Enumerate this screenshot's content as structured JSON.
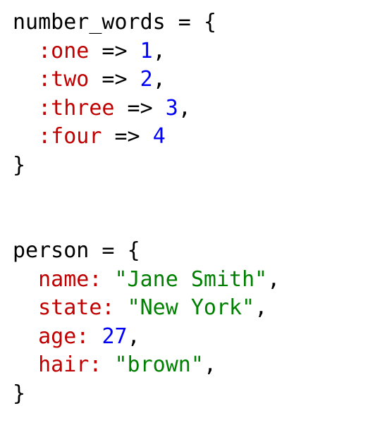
{
  "block1": {
    "varName": "number_words",
    "assign": " = ",
    "openBrace": "{",
    "closeBrace": "}",
    "entries": [
      {
        "key": ":one",
        "arrow": " => ",
        "value": "1",
        "comma": ","
      },
      {
        "key": ":two",
        "arrow": " => ",
        "value": "2",
        "comma": ","
      },
      {
        "key": ":three",
        "arrow": " => ",
        "value": "3",
        "comma": ","
      },
      {
        "key": ":four",
        "arrow": " => ",
        "value": "4",
        "comma": ""
      }
    ]
  },
  "block2": {
    "varName": "person",
    "assign": " = ",
    "openBrace": "{",
    "closeBrace": "}",
    "entries": [
      {
        "key": "name:",
        "space": " ",
        "value": "\"Jane Smith\"",
        "valueType": "str",
        "comma": ","
      },
      {
        "key": "state:",
        "space": " ",
        "value": "\"New York\"",
        "valueType": "str",
        "comma": ","
      },
      {
        "key": "age:",
        "space": " ",
        "value": "27",
        "valueType": "num",
        "comma": ","
      },
      {
        "key": "hair:",
        "space": " ",
        "value": "\"brown\"",
        "valueType": "str",
        "comma": ","
      }
    ]
  }
}
